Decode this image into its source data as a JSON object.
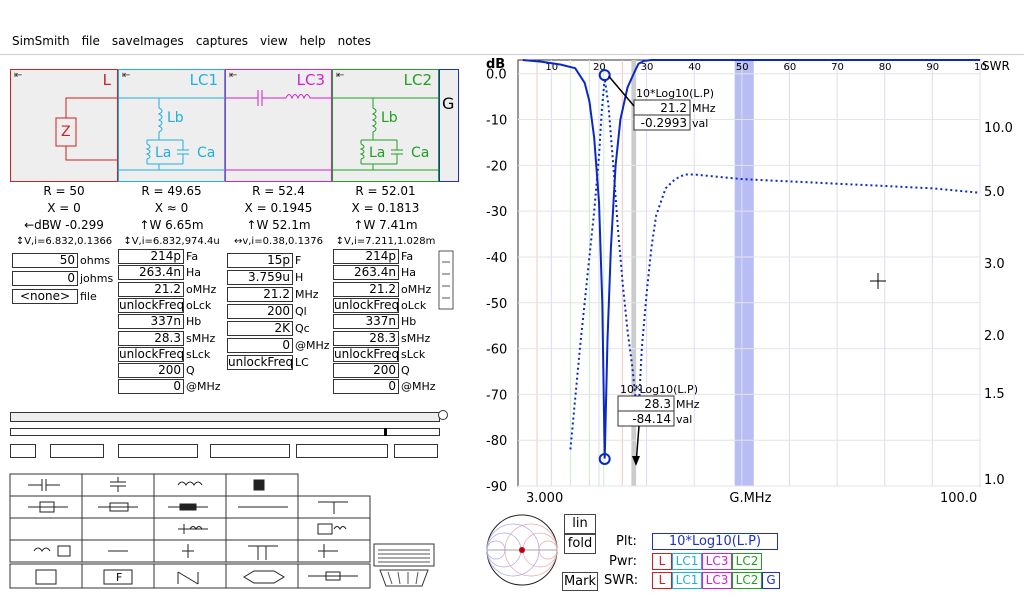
{
  "menu": {
    "app": "SimSmith",
    "items": [
      "file",
      "saveImages",
      "captures",
      "view",
      "help",
      "notes"
    ]
  },
  "panels": [
    {
      "title": "L",
      "color": "#d02020",
      "info": [
        "R = 50",
        "X = 0",
        "←dBW -0.299",
        "↕V,i=6.832,0.1366"
      ]
    },
    {
      "title": "LC1",
      "color": "#20b0e0",
      "info": [
        "R = 49.65",
        "X ≈ 0",
        "↑W 6.65m",
        "↕V,i=6.832,974.4u"
      ]
    },
    {
      "title": "LC3",
      "color": "#d020d0",
      "info": [
        "R = 52.4",
        "X = 0.1945",
        "↑W 52.1m",
        "↔v,i=0.38,0.1376"
      ]
    },
    {
      "title": "LC2",
      "color": "#20a020",
      "info": [
        "R = 52.01",
        "X = 0.1813",
        "↑W 7.41m",
        "↕V,i=7.211,1.028m"
      ]
    },
    {
      "title": "G",
      "color": "#2030c0"
    }
  ],
  "load": {
    "f1": "50",
    "u1": "ohms",
    "f2": "0",
    "u2": "johms",
    "f3": "<none>",
    "u3": "file",
    "z": "Z"
  },
  "lc1": {
    "part_lb": "Lb",
    "part_la": "La",
    "part_ca": "Ca",
    "fields": [
      [
        "214p",
        "Fa"
      ],
      [
        "263.4n",
        "Ha"
      ],
      [
        "21.2",
        "oMHz"
      ],
      [
        "unlockFreq",
        "oLck"
      ],
      [
        "337n",
        "Hb"
      ],
      [
        "28.3",
        "sMHz"
      ],
      [
        "unlockFreq",
        "sLck"
      ],
      [
        "200",
        "Q"
      ],
      [
        "0",
        "@MHz"
      ]
    ]
  },
  "lc3": {
    "fields": [
      [
        "15p",
        "F"
      ],
      [
        "3.759u",
        "H"
      ],
      [
        "21.2",
        "MHz"
      ],
      [
        "200",
        "Ql"
      ],
      [
        "2K",
        "Qc"
      ],
      [
        "0",
        "@MHz"
      ],
      [
        "unlockFreq",
        "LC"
      ]
    ]
  },
  "lc2": {
    "part_lb": "Lb",
    "part_la": "La",
    "part_ca": "Ca",
    "fields": [
      [
        "214p",
        "Fa"
      ],
      [
        "263.4n",
        "Ha"
      ],
      [
        "21.2",
        "oMHz"
      ],
      [
        "unlockFreq",
        "oLck"
      ],
      [
        "337n",
        "Hb"
      ],
      [
        "28.3",
        "sMHz"
      ],
      [
        "unlockFreq",
        "sLck"
      ],
      [
        "200",
        "Q"
      ],
      [
        "0",
        "@MHz"
      ]
    ]
  },
  "gen": {
    "label": "G"
  },
  "chart_data": {
    "type": "line",
    "title": "",
    "xlabel": "G.MHz",
    "x_range": [
      3,
      100
    ],
    "x_start_label": "3.000",
    "x_end_label": "100.0",
    "x_top_ticks": [
      "10",
      "20",
      "30",
      "40",
      "50",
      "60",
      "70",
      "80",
      "90",
      "10"
    ],
    "ylabel_left": "dB",
    "ylim": [
      -90,
      3
    ],
    "y_ticks": [
      "0.0",
      "-10",
      "-20",
      "-30",
      "-40",
      "-50",
      "-60",
      "-70",
      "-80",
      "-90"
    ],
    "ylabel_right": "SWR",
    "swr_ticks": [
      "10.0",
      "5.0",
      "3.0",
      "2.0",
      "1.5",
      "1.0"
    ],
    "series": [
      {
        "name": "10*Log10(L.P)",
        "style": "solid",
        "color": "#0a28c8",
        "x": [
          4,
          8,
          12,
          15,
          17,
          18,
          19,
          20,
          20.7,
          21.2,
          21.8,
          22.5,
          23.5,
          24.5,
          26,
          27.5,
          28.3,
          29.5,
          31,
          33,
          36,
          40,
          45,
          52,
          60,
          70,
          80,
          90,
          100
        ],
        "y": [
          3,
          2.6,
          2,
          1.2,
          -2,
          -6,
          -14,
          -28,
          -50,
          -84,
          -58,
          -38,
          -20,
          -10,
          -3,
          0.5,
          2.2,
          2.8,
          3,
          3,
          3,
          3,
          3,
          3,
          3,
          3,
          3,
          3,
          3
        ]
      },
      {
        "name": "SWR",
        "style": "dotted",
        "color": "#0a28c8",
        "x": [
          14,
          16,
          18,
          19,
          20,
          20.6,
          21.2,
          22,
          23,
          24,
          25,
          26,
          27,
          27.6,
          28,
          28.3,
          28.6,
          29,
          30,
          31,
          32,
          34,
          36,
          38,
          40,
          45,
          50,
          60,
          70,
          80,
          90,
          100
        ],
        "y": [
          -82,
          -60,
          -40,
          -30,
          -18,
          -8,
          -1,
          -7,
          -20,
          -34,
          -46,
          -56,
          -64,
          -70,
          -74,
          -75,
          -68,
          -60,
          -48,
          -38,
          -31,
          -25,
          -23,
          -22,
          -22,
          -22.5,
          -23,
          -23.5,
          -24,
          -24.5,
          -25,
          -26
        ]
      }
    ],
    "markers": [
      {
        "label": "10*Log10(L.P)",
        "freq": "21.2",
        "freq_unit": "MHz",
        "value": "-0.2993",
        "value_unit": "val"
      },
      {
        "label": "10*Log10(L.P)",
        "freq": "28.3",
        "freq_unit": "MHz",
        "value": "-84.14",
        "value_unit": "val"
      }
    ],
    "grid": true
  },
  "controls": {
    "lin": "lin",
    "fold": "fold",
    "mark": "Mark",
    "plt_label": "Plt:",
    "plt_value": "10*Log10(L.P)",
    "pwr_label": "Pwr:",
    "swr_label": "SWR:",
    "pwr_items": [
      "L",
      "LC1",
      "LC3",
      "LC2"
    ],
    "swr_items": [
      "L",
      "LC1",
      "LC3",
      "LC2",
      "G"
    ]
  }
}
